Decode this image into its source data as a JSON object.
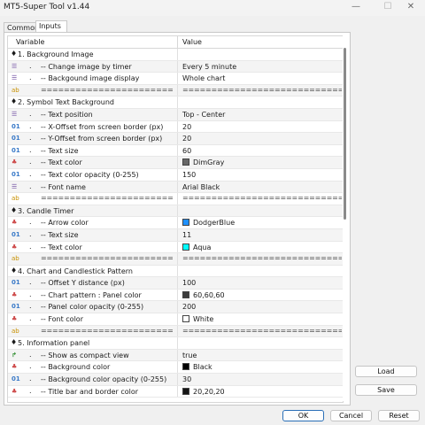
{
  "window": {
    "title": "MT5-Super Tool v1.44",
    "minimize": "—",
    "maximize": "☐",
    "close": "✕"
  },
  "tabs": [
    {
      "label": "Common"
    },
    {
      "label": "Inputs"
    }
  ],
  "columns": {
    "variable": "Variable",
    "value": "Value"
  },
  "rows": [
    {
      "type": "group",
      "name": "1. Background Image"
    },
    {
      "type": "param",
      "icon": "enum",
      "name": "--  Change image by timer",
      "value": "Every 5 minute"
    },
    {
      "type": "param",
      "icon": "enum",
      "name": "--  Backgound image display",
      "value": "Whole chart"
    },
    {
      "type": "sep"
    },
    {
      "type": "group",
      "name": "2. Symbol Text Background"
    },
    {
      "type": "param",
      "icon": "enum",
      "name": "--  Text position",
      "value": "Top - Center"
    },
    {
      "type": "param",
      "icon": "int",
      "name": "--  X-Offset from screen border (px)",
      "value": "20"
    },
    {
      "type": "param",
      "icon": "int",
      "name": "--  Y-Offset from screen border (px)",
      "value": "20"
    },
    {
      "type": "param",
      "icon": "int",
      "name": "--  Text size",
      "value": "60"
    },
    {
      "type": "param",
      "icon": "color",
      "name": "--  Text color",
      "value": "DimGray",
      "swatch": "#696969"
    },
    {
      "type": "param",
      "icon": "int",
      "name": "--  Text color opacity (0-255)",
      "value": "150"
    },
    {
      "type": "param",
      "icon": "enum",
      "name": "--  Font name",
      "value": "Arial Black"
    },
    {
      "type": "sep"
    },
    {
      "type": "group",
      "name": "3. Candle Timer"
    },
    {
      "type": "param",
      "icon": "color",
      "name": "--  Arrow color",
      "value": "DodgerBlue",
      "swatch": "#1e90ff"
    },
    {
      "type": "param",
      "icon": "int",
      "name": "--  Text size",
      "value": "11"
    },
    {
      "type": "param",
      "icon": "color",
      "name": "--  Text color",
      "value": "Aqua",
      "swatch": "#00ffff"
    },
    {
      "type": "sep"
    },
    {
      "type": "group",
      "name": "4. Chart and Candlestick Pattern"
    },
    {
      "type": "param",
      "icon": "int",
      "name": "--  Offset Y distance (px)",
      "value": "100"
    },
    {
      "type": "param",
      "icon": "color",
      "name": "--  Chart pattern : Panel color",
      "value": "60,60,60",
      "swatch": "#3c3c3c"
    },
    {
      "type": "param",
      "icon": "int",
      "name": "--  Panel color opacity (0-255)",
      "value": "200"
    },
    {
      "type": "param",
      "icon": "color",
      "name": "--  Font color",
      "value": "White",
      "swatch": "#ffffff"
    },
    {
      "type": "sep"
    },
    {
      "type": "group",
      "name": "5. Information panel"
    },
    {
      "type": "param",
      "icon": "bool",
      "name": "--  Show as compact view",
      "value": "true"
    },
    {
      "type": "param",
      "icon": "color",
      "name": "--  Background color",
      "value": "Black",
      "swatch": "#000000"
    },
    {
      "type": "param",
      "icon": "int",
      "name": "--  Background color opacity (0-255)",
      "value": "30"
    },
    {
      "type": "param",
      "icon": "color",
      "name": "--  Title bar and border color",
      "value": "20,20,20",
      "swatch": "#141414"
    }
  ],
  "separator_text": "=======================================================",
  "icon_glyphs": {
    "enum": "☰",
    "int": "01",
    "color": "♣",
    "string": "ab",
    "bool": "↱"
  },
  "buttons": {
    "load": "Load",
    "save": "Save",
    "ok": "OK",
    "cancel": "Cancel",
    "reset": "Reset"
  }
}
